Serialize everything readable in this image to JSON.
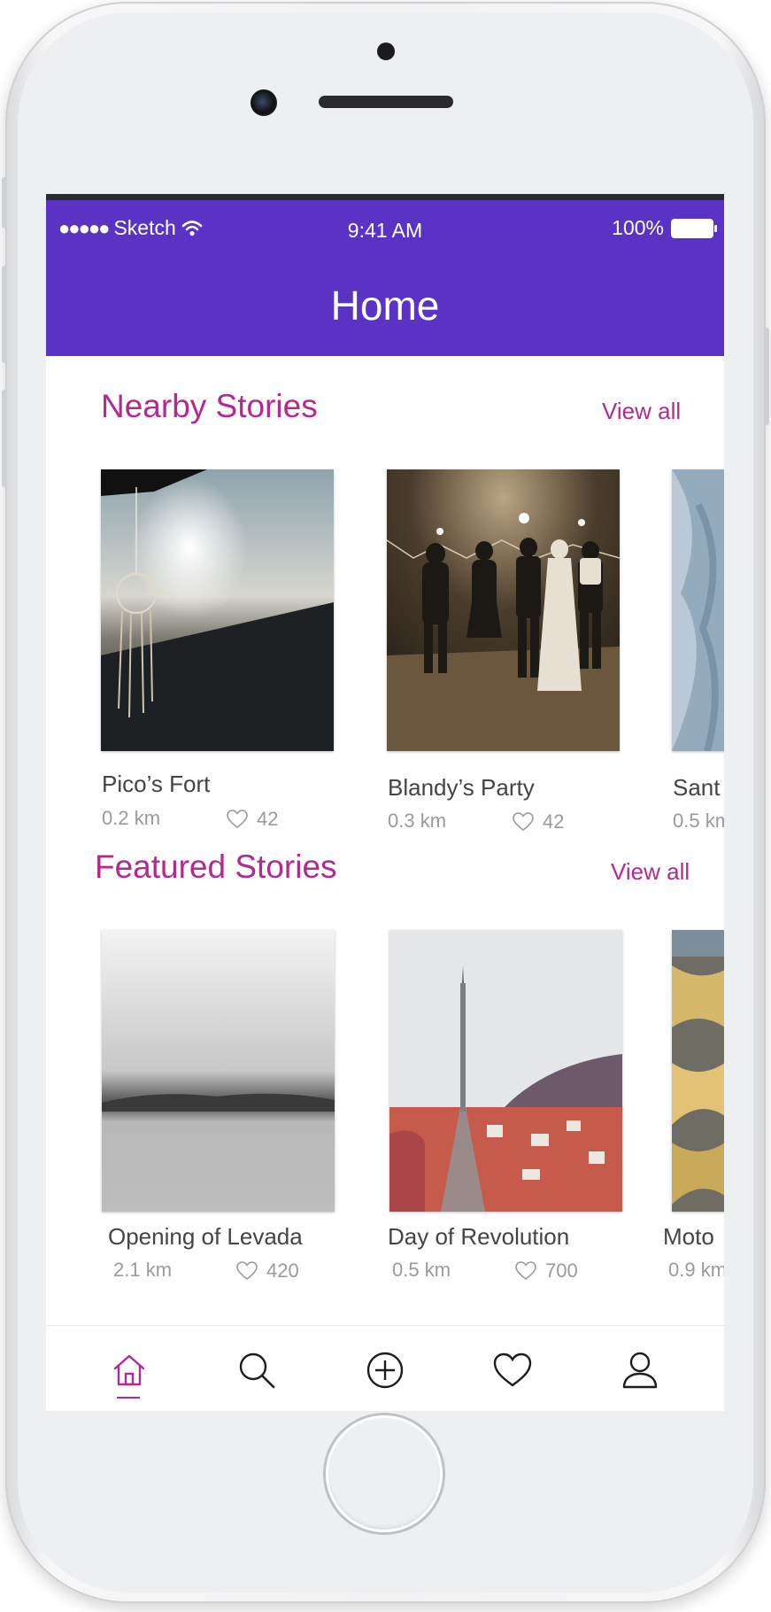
{
  "status_bar": {
    "carrier": "Sketch",
    "time": "9:41 AM",
    "battery": "100%"
  },
  "navbar": {
    "title": "Home"
  },
  "nearby": {
    "title": "Nearby Stories",
    "view_all": "View all",
    "items": [
      {
        "title": "Pico’s Fort",
        "distance": "0.2 km",
        "likes": "42"
      },
      {
        "title": "Blandy’s Party",
        "distance": "0.3 km",
        "likes": "42"
      },
      {
        "title": "Sant",
        "distance": "0.5 km",
        "likes": ""
      }
    ]
  },
  "featured": {
    "title": "Featured Stories",
    "view_all": "View all",
    "items": [
      {
        "title": "Opening of Levada",
        "distance": "2.1 km",
        "likes": "420"
      },
      {
        "title": "Day of Revolution",
        "distance": "0.5 km",
        "likes": "700"
      },
      {
        "title": "Moto",
        "distance": "0.9 km",
        "likes": ""
      }
    ]
  },
  "tabbar": {
    "tabs": [
      {
        "icon": "home-icon",
        "active": true
      },
      {
        "icon": "search-icon",
        "active": false
      },
      {
        "icon": "add-circle-icon",
        "active": false
      },
      {
        "icon": "heart-icon",
        "active": false
      },
      {
        "icon": "profile-icon",
        "active": false
      }
    ]
  },
  "colors": {
    "navbar": "#5b33c4",
    "accent": "#b5298f",
    "text": "#444444",
    "muted": "#9a9a9a"
  }
}
